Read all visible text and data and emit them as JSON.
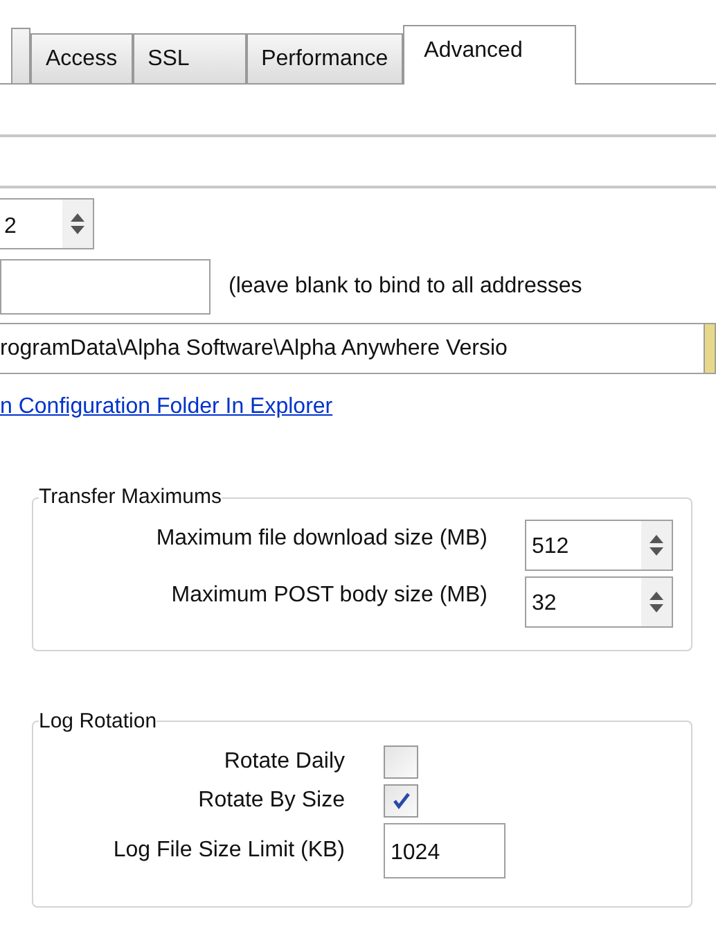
{
  "tabs": [
    {
      "label": "Access",
      "selected": false
    },
    {
      "label": "SSL",
      "selected": false
    },
    {
      "label": "Performance",
      "selected": false
    },
    {
      "label": "Advanced",
      "selected": true
    }
  ],
  "port": {
    "value": "2"
  },
  "bind_address": {
    "hint": "(leave blank to bind to all addresses"
  },
  "config_folder": {
    "value": "rogramData\\Alpha Software\\Alpha Anywhere Versio",
    "link": "n Configuration Folder In Explorer"
  },
  "transfer_maximums": {
    "title": "Transfer Maximums",
    "rows": [
      {
        "label": "Maximum file download size (MB)",
        "value": "512"
      },
      {
        "label": "Maximum POST body size (MB)",
        "value": "32"
      }
    ]
  },
  "log_rotation": {
    "title": "Log Rotation",
    "rows": [
      {
        "kind": "checkbox",
        "label": "Rotate Daily",
        "checked": false
      },
      {
        "kind": "checkbox",
        "label": "Rotate By Size",
        "checked": true
      },
      {
        "kind": "field",
        "label": "Log File Size Limit (KB)",
        "value": "1024"
      }
    ]
  }
}
